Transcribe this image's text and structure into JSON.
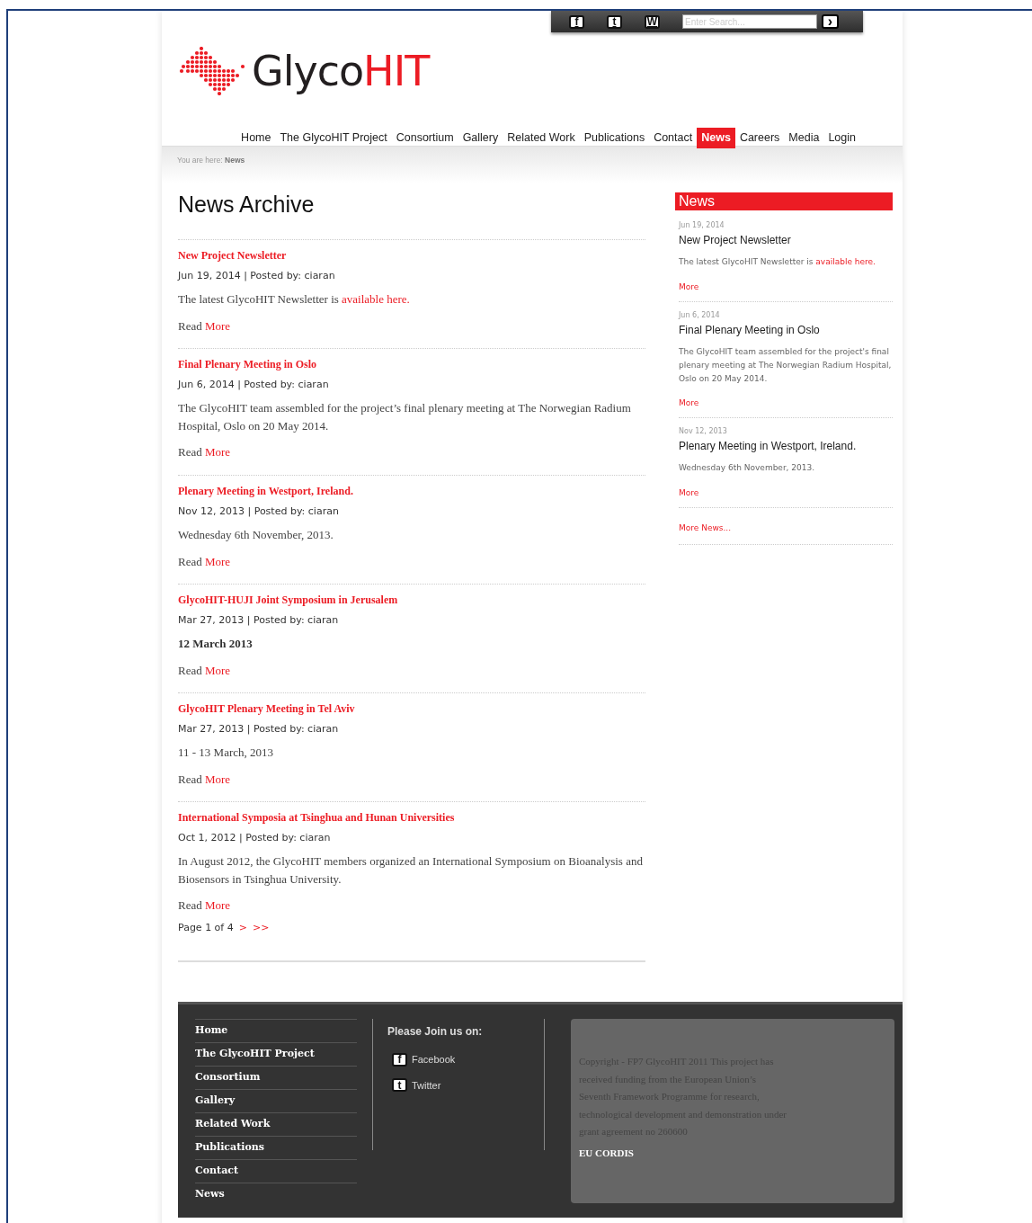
{
  "top_bar": {
    "icons": [
      {
        "glyph": "f"
      },
      {
        "glyph": "t"
      },
      {
        "glyph": "W"
      }
    ],
    "search": {
      "placeholder": "Enter Search..."
    },
    "go_glyph": "›"
  },
  "brand": {
    "text_dark": "Glyco",
    "text_accent": "HIT"
  },
  "nav": [
    {
      "label": "Home",
      "selected": false
    },
    {
      "label": "The GlycoHIT Project",
      "selected": false
    },
    {
      "label": "Consortium",
      "selected": false
    },
    {
      "label": "Gallery",
      "selected": false
    },
    {
      "label": "Related Work",
      "selected": false
    },
    {
      "label": "Publications",
      "selected": false
    },
    {
      "label": "Contact",
      "selected": false
    },
    {
      "label": "News",
      "selected": true
    },
    {
      "label": "Careers",
      "selected": false
    },
    {
      "label": "Media",
      "selected": false
    },
    {
      "label": "Login",
      "selected": false
    }
  ],
  "breadcrumb": "You are here: **News**",
  "page_title": "News Archive",
  "articles": [
    {
      "title": "New Project Newsletter",
      "meta": "Jun 19, 2014 | Posted by: ciaran",
      "body": "The latest GlycoHIT Newsletter is ",
      "body_link": "available here.",
      "emphasis": false,
      "read": "Read ",
      "more": "More"
    },
    {
      "title": "Final Plenary Meeting in Oslo",
      "meta": "Jun 6, 2014 | Posted by: ciaran",
      "body": "The GlycoHIT team assembled for the project’s final plenary meeting at The Norwegian Radium Hospital, Oslo on 20 May 2014.",
      "emphasis": false,
      "read": "Read ",
      "more": "More"
    },
    {
      "title": "Plenary Meeting in Westport, Ireland.",
      "meta": "Nov 12, 2013 | Posted by: ciaran",
      "body": "Wednesday 6th November, 2013.",
      "emphasis": false,
      "read": "Read ",
      "more": "More"
    },
    {
      "title": "GlycoHIT-HUJI Joint Symposium in Jerusalem",
      "meta": "Mar 27, 2013 | Posted by: ciaran",
      "body": "12 March 2013",
      "emphasis": true,
      "read": "Read ",
      "more": "More"
    },
    {
      "title": "GlycoHIT Plenary Meeting in Tel Aviv",
      "meta": "Mar 27, 2013 | Posted by: ciaran",
      "body": "11 - 13 March, 2013",
      "emphasis": false,
      "read": "Read ",
      "more": "More"
    },
    {
      "title": "International Symposia at Tsinghua and Hunan Universities",
      "meta": "Oct 1, 2012 | Posted by: ciaran",
      "body": "In August 2012, the GlycoHIT members organized an International Symposium on Bioanalysis and Biosensors in Tsinghua University.",
      "emphasis": false,
      "read": "Read ",
      "more": "More"
    }
  ],
  "pagination": {
    "text": "Page 1 of 4",
    "links": [
      ">",
      ">>"
    ]
  },
  "sidebar": {
    "heading": "News",
    "items": [
      {
        "date": "Jun 19, 2014",
        "title": "New Project Newsletter",
        "text": "The latest GlycoHIT Newsletter is ",
        "text_link": "available here.",
        "more": "More"
      },
      {
        "date": "Jun 6, 2014",
        "title": "Final Plenary Meeting in Oslo",
        "text": "The GlycoHIT team assembled for the project's final plenary meeting at The Norwegian Radium Hospital, Oslo on 20 May 2014.",
        "more": "More"
      },
      {
        "date": "Nov 12, 2013",
        "title": "Plenary Meeting in Westport, Ireland.",
        "text": "Wednesday 6th November, 2013.",
        "more": "More"
      }
    ],
    "more_news": "More News..."
  },
  "footer": {
    "links": [
      "Home",
      "The GlycoHIT Project",
      "Consortium",
      "Gallery",
      "Related Work",
      "Publications",
      "Contact",
      "News"
    ],
    "join_heading": "Please Join us on:",
    "socials": [
      {
        "glyph": "f",
        "label": "Facebook"
      },
      {
        "glyph": "t",
        "label": "Twitter"
      }
    ],
    "copyright": "Copyright - FP7 GlycoHIT 2011 This project has received funding from the European Union’s Seventh Framework Programme for research, technological development and demonstration under grant agreement no 260600",
    "cordis": "EU CORDIS"
  }
}
